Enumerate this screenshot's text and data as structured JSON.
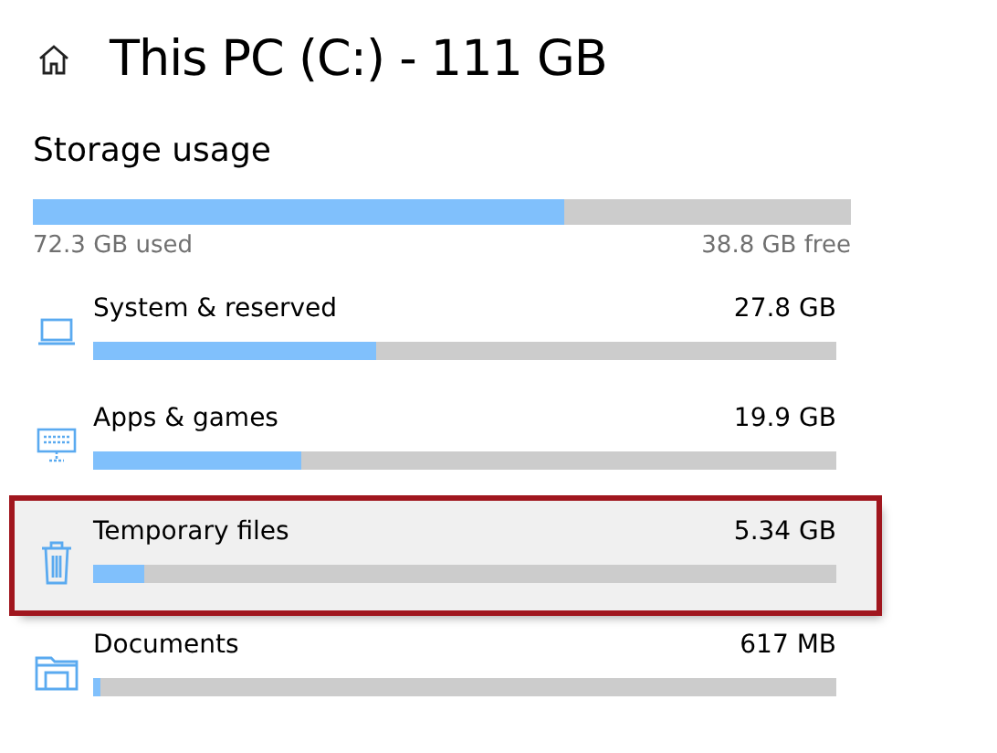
{
  "title": "This PC (C:) - 111 GB",
  "section": "Storage usage",
  "usage": {
    "level": 0.65,
    "used": "72.3 GB used",
    "free": "38.8 GB free"
  },
  "items": [
    {
      "kind": "system",
      "name": "System & reserved",
      "size": "27.8 GB",
      "level": 0.38,
      "highlighted": false
    },
    {
      "kind": "apps",
      "name": "Apps & games",
      "size": "19.9 GB",
      "level": 0.28,
      "highlighted": false
    },
    {
      "kind": "temp",
      "name": "Temporary files",
      "size": "5.34 GB",
      "level": 0.07,
      "highlighted": true
    },
    {
      "kind": "documents",
      "name": "Documents",
      "size": "617 MB",
      "level": 0.01,
      "highlighted": false
    }
  ]
}
